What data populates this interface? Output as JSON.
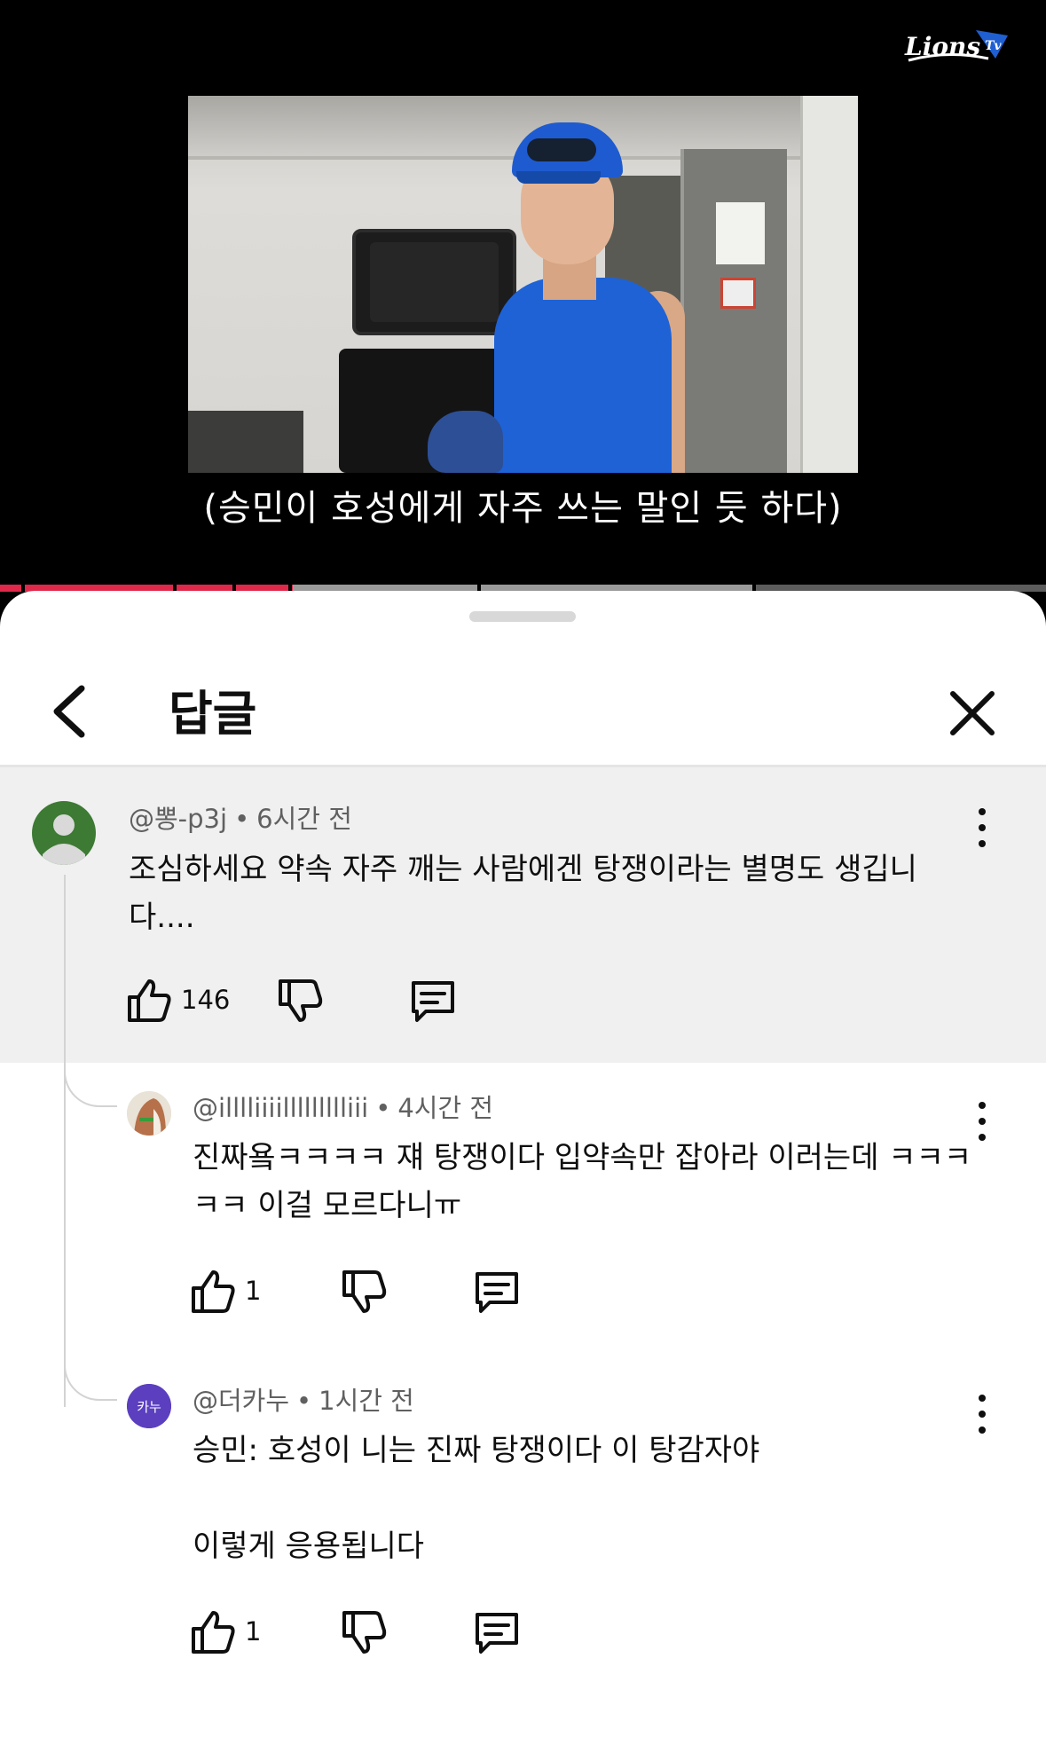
{
  "video": {
    "channel_logo": "Lions TV",
    "subtitle": "(승민이 호성에게 자주 쓰는 말인 듯 하다)",
    "progress_fraction": 0.28,
    "accent_color": "#e0284a"
  },
  "sheet": {
    "title": "답글",
    "back_icon": "chevron-left-icon",
    "close_icon": "close-icon"
  },
  "comments": [
    {
      "author": "@뽕-p3j",
      "time": "6시간 전",
      "text": "조심하세요 약속 자주 깨는 사람에겐 탕쟁이라는 별명도 생깁니다....",
      "likes": "146",
      "avatar_color": "#3d7a34"
    },
    {
      "author": "@illlliiiillllllllliii",
      "time": "4시간 전",
      "text": "진짜욬ㅋㅋㅋㅋ 쟤 탕쟁이다 입약속만 잡아라 이러는데 ㅋㅋㅋㅋㅋ 이걸 모르다니ㅠ",
      "likes": "1"
    },
    {
      "author": "@더카누",
      "time": "1시간 전",
      "text_line1": "승민: 호성이 니는 진짜 탕쟁이다 이 탕감자야",
      "text_line2": "이렇게 응용됩니다",
      "likes": "1",
      "avatar_label": "카누",
      "avatar_color": "#5b3fbf"
    }
  ]
}
